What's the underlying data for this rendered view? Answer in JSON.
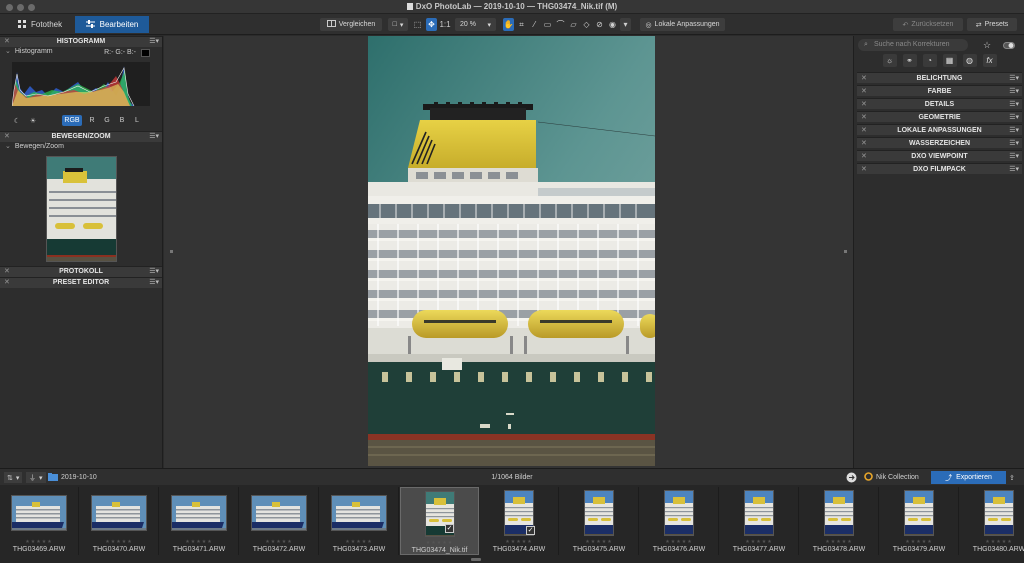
{
  "window": {
    "title": "DxO PhotoLab — 2019-10-10 — THG03474_Nik.tif (M)"
  },
  "toolbar": {
    "tab_library": "Fotothek",
    "tab_customize": "Bearbeiten",
    "compare_label": "Vergleichen",
    "zoom_ratio": "1:1",
    "zoom_level": "20 %",
    "local_adjust_label": "Lokale Anpassungen",
    "reset_label": "Zurücksetzen",
    "presets_label": "Presets"
  },
  "left_panel": {
    "histogram_title": "HISTOGRAMM",
    "histogram_sub": "Histogramm",
    "rgb_readout": "R:- G:- B:-",
    "channel_buttons": [
      "RGB",
      "R",
      "G",
      "B",
      "L"
    ],
    "move_zoom_title": "BEWEGEN/ZOOM",
    "move_zoom_sub": "Bewegen/Zoom",
    "history_title": "PROTOKOLL",
    "preset_editor_title": "PRESET EDITOR"
  },
  "right_panel": {
    "search_placeholder": "Suche nach Korrekturen",
    "sections": [
      "BELICHTUNG",
      "FARBE",
      "DETAILS",
      "GEOMETRIE",
      "LOKALE ANPASSUNGEN",
      "WASSERZEICHEN",
      "DXO VIEWPOINT",
      "DXO FILMPACK"
    ]
  },
  "filmstrip_bar": {
    "folder_name": "2019-10-10",
    "image_count": "1/1064 Bilder",
    "nik_label": "Nik Collection",
    "export_label": "Exportieren"
  },
  "filmstrip": {
    "items": [
      {
        "name": "THG03469.ARW"
      },
      {
        "name": "THG03470.ARW"
      },
      {
        "name": "THG03471.ARW"
      },
      {
        "name": "THG03472.ARW"
      },
      {
        "name": "THG03473.ARW"
      },
      {
        "name": "THG03474_Nik.tif"
      },
      {
        "name": "THG03474.ARW"
      },
      {
        "name": "THG03475.ARW"
      },
      {
        "name": "THG03476.ARW"
      },
      {
        "name": "THG03477.ARW"
      },
      {
        "name": "THG03478.ARW"
      },
      {
        "name": "THG03479.ARW"
      },
      {
        "name": "THG03480.ARW"
      }
    ]
  },
  "colors": {
    "accent": "#2b6cb8",
    "active_tab": "#1e5a99"
  }
}
